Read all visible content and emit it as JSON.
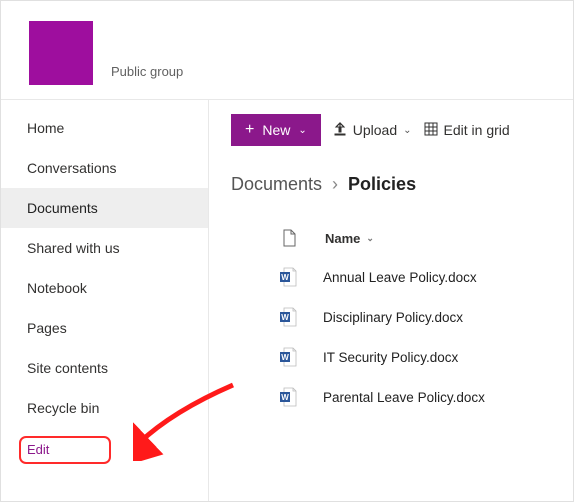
{
  "header": {
    "group_label": "Public group"
  },
  "sidebar": {
    "items": [
      {
        "label": "Home"
      },
      {
        "label": "Conversations"
      },
      {
        "label": "Documents",
        "active": true
      },
      {
        "label": "Shared with us"
      },
      {
        "label": "Notebook"
      },
      {
        "label": "Pages"
      },
      {
        "label": "Site contents"
      },
      {
        "label": "Recycle bin"
      }
    ],
    "edit_label": "Edit"
  },
  "toolbar": {
    "new_label": "New",
    "upload_label": "Upload",
    "grid_label": "Edit in grid"
  },
  "breadcrumb": {
    "root": "Documents",
    "current": "Policies"
  },
  "list": {
    "name_header": "Name",
    "rows": [
      {
        "name": "Annual Leave Policy.docx"
      },
      {
        "name": "Disciplinary Policy.docx"
      },
      {
        "name": "IT Security Policy.docx"
      },
      {
        "name": "Parental Leave Policy.docx"
      }
    ]
  },
  "colors": {
    "brand": "#8b188b"
  }
}
